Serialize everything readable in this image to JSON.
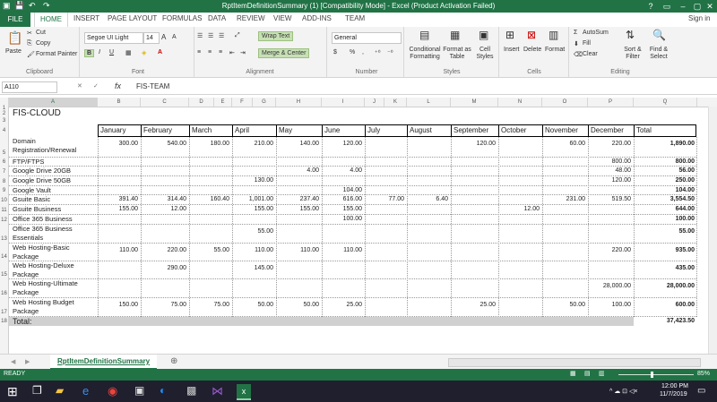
{
  "window": {
    "title": "RptItemDefinitionSummary (1)  [Compatibility Mode] - Excel (Product Activation Failed)",
    "help": "?",
    "sign_in": "Sign in"
  },
  "ribbon_tabs": [
    "FILE",
    "HOME",
    "INSERT",
    "PAGE LAYOUT",
    "FORMULAS",
    "DATA",
    "REVIEW",
    "VIEW",
    "ADD-INS",
    "TEAM"
  ],
  "ribbon": {
    "clipboard": {
      "paste": "Paste",
      "cut": "Cut",
      "copy": "Copy",
      "format_painter": "Format Painter",
      "label": "Clipboard"
    },
    "font": {
      "name": "Segoe UI Light",
      "size": "14",
      "bold": "B",
      "italic": "I",
      "underline": "U",
      "grow": "A",
      "shrink": "A",
      "label": "Font"
    },
    "alignment": {
      "wrap_text": "Wrap Text",
      "merge": "Merge & Center",
      "label": "Alignment"
    },
    "number": {
      "format": "General",
      "currency": "$",
      "percent": "%",
      "comma": ",",
      "label": "Number"
    },
    "styles": {
      "conditional": "Conditional Formatting",
      "format_table": "Format as Table",
      "cell_styles": "Cell Styles",
      "label": "Styles"
    },
    "cells": {
      "insert": "Insert",
      "delete": "Delete",
      "format": "Format",
      "label": "Cells"
    },
    "editing": {
      "autosum": "AutoSum",
      "fill": "Fill",
      "clear": "Clear",
      "sort": "Sort & Filter",
      "find": "Find & Select",
      "label": "Editing"
    }
  },
  "formula_bar": {
    "name_box": "A110",
    "fx": "fx",
    "content": "FIS-TEAM"
  },
  "columns": [
    "A",
    "B",
    "C",
    "D",
    "E",
    "F",
    "G",
    "H",
    "I",
    "J",
    "K",
    "L",
    "M",
    "N",
    "O",
    "P",
    "Q"
  ],
  "sheet": {
    "title": "FIS-CLOUD",
    "headers": [
      "January",
      "February",
      "March",
      "April",
      "May",
      "June",
      "July",
      "August",
      "September",
      "October",
      "November",
      "December",
      "Total"
    ],
    "rows": [
      {
        "rownum": "5",
        "name": "Domain Registration/Renewal",
        "v": [
          "300.00",
          "540.00",
          "180.00",
          "210.00",
          "140.00",
          "120.00",
          "",
          "",
          "120.00",
          "",
          "60.00",
          "220.00"
        ],
        "total": "1,890.00"
      },
      {
        "rownum": "6",
        "name": "FTP/FTPS",
        "v": [
          "",
          "",
          "",
          "",
          "",
          "",
          "",
          "",
          "",
          "",
          "",
          "800.00"
        ],
        "total": "800.00"
      },
      {
        "rownum": "7",
        "name": "Google Drive 20GB",
        "v": [
          "",
          "",
          "",
          "",
          "4.00",
          "4.00",
          "",
          "",
          "",
          "",
          "",
          "48.00"
        ],
        "total": "56.00"
      },
      {
        "rownum": "8",
        "name": "Google Drive 50GB",
        "v": [
          "",
          "",
          "",
          "130.00",
          "",
          "",
          "",
          "",
          "",
          "",
          "",
          "120.00"
        ],
        "total": "250.00"
      },
      {
        "rownum": "9",
        "name": "Google Vault",
        "v": [
          "",
          "",
          "",
          "",
          "",
          "104.00",
          "",
          "",
          "",
          "",
          "",
          ""
        ],
        "total": "104.00"
      },
      {
        "rownum": "10",
        "name": "Gsuite Basic",
        "v": [
          "391.40",
          "314.40",
          "160.40",
          "1,001.00",
          "237.40",
          "616.00",
          "77.00",
          "6.40",
          "",
          "",
          "231.00",
          "519.50"
        ],
        "total": "3,554.50"
      },
      {
        "rownum": "11",
        "name": "Gsuite Business",
        "v": [
          "155.00",
          "12.00",
          "",
          "155.00",
          "155.00",
          "155.00",
          "",
          "",
          "",
          "12.00",
          "",
          ""
        ],
        "total": "644.00"
      },
      {
        "rownum": "12",
        "name": "Office 365 Business",
        "v": [
          "",
          "",
          "",
          "",
          "",
          "100.00",
          "",
          "",
          "",
          "",
          "",
          ""
        ],
        "total": "100.00"
      },
      {
        "rownum": "13",
        "name": "Office 365 Business Essentials",
        "v": [
          "",
          "",
          "",
          "55.00",
          "",
          "",
          "",
          "",
          "",
          "",
          "",
          ""
        ],
        "total": "55.00"
      },
      {
        "rownum": "14",
        "name": "Web  Hosting-Basic Package",
        "v": [
          "110.00",
          "220.00",
          "55.00",
          "110.00",
          "110.00",
          "110.00",
          "",
          "",
          "",
          "",
          "",
          "220.00"
        ],
        "total": "935.00"
      },
      {
        "rownum": "15",
        "name": "Web  Hosting-Deluxe Package",
        "v": [
          "",
          "290.00",
          "",
          "145.00",
          "",
          "",
          "",
          "",
          "",
          "",
          "",
          ""
        ],
        "total": "435.00"
      },
      {
        "rownum": "16",
        "name": "Web  Hosting-Ultimate Package",
        "v": [
          "",
          "",
          "",
          "",
          "",
          "",
          "",
          "",
          "",
          "",
          "",
          "28,000.00"
        ],
        "total": "28,000.00"
      },
      {
        "rownum": "17",
        "name": "Web Hosting Budget Package",
        "v": [
          "150.00",
          "75.00",
          "75.00",
          "50.00",
          "50.00",
          "25.00",
          "",
          "",
          "25.00",
          "",
          "50.00",
          "100.00"
        ],
        "total": "600.00"
      }
    ],
    "total_label": "Total:",
    "grand_total": "37,423.50"
  },
  "sheet_tab": "RptItemDefinitionSummary",
  "status": {
    "text": "READY",
    "zoom": "85%"
  },
  "clock": {
    "time": "12:00 PM",
    "date": "11/7/2019"
  },
  "colors": {
    "excel_green": "#217346",
    "total_row": "#d0d0d0"
  }
}
